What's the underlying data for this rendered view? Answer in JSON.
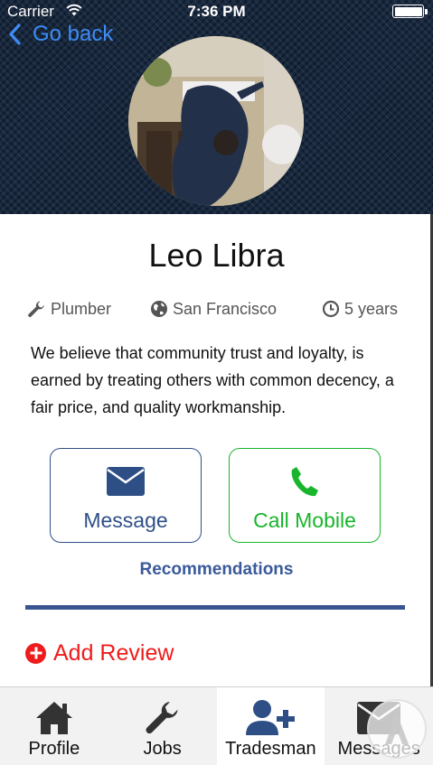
{
  "status_bar": {
    "carrier": "Carrier",
    "time": "7:36 PM",
    "battery_level": 1.0
  },
  "nav": {
    "back_label": "Go back",
    "back_color": "#3d8cf6"
  },
  "profile": {
    "name": "Leo Libra",
    "trade": "Plumber",
    "city": "San Francisco",
    "experience": "5 years",
    "bio": "We believe that community trust and loyalty, is earned by treating others with common decency, a fair price, and quality workmanship."
  },
  "actions": {
    "message_label": "Message",
    "call_label": "Call Mobile",
    "message_color": "#2e4f86",
    "call_color": "#19b52c"
  },
  "recommendations": {
    "title": "Recommendations"
  },
  "reviews": {
    "add_label": "Add Review",
    "add_color": "#ee1c1c"
  },
  "tabbar": {
    "tabs": [
      {
        "label": "Profile",
        "icon": "home-icon",
        "active": false
      },
      {
        "label": "Jobs",
        "icon": "wrench-icon",
        "active": false
      },
      {
        "label": "Tradesman",
        "icon": "add-user-icon",
        "active": true
      },
      {
        "label": "Messages",
        "icon": "envelope-icon",
        "active": false
      }
    ]
  }
}
